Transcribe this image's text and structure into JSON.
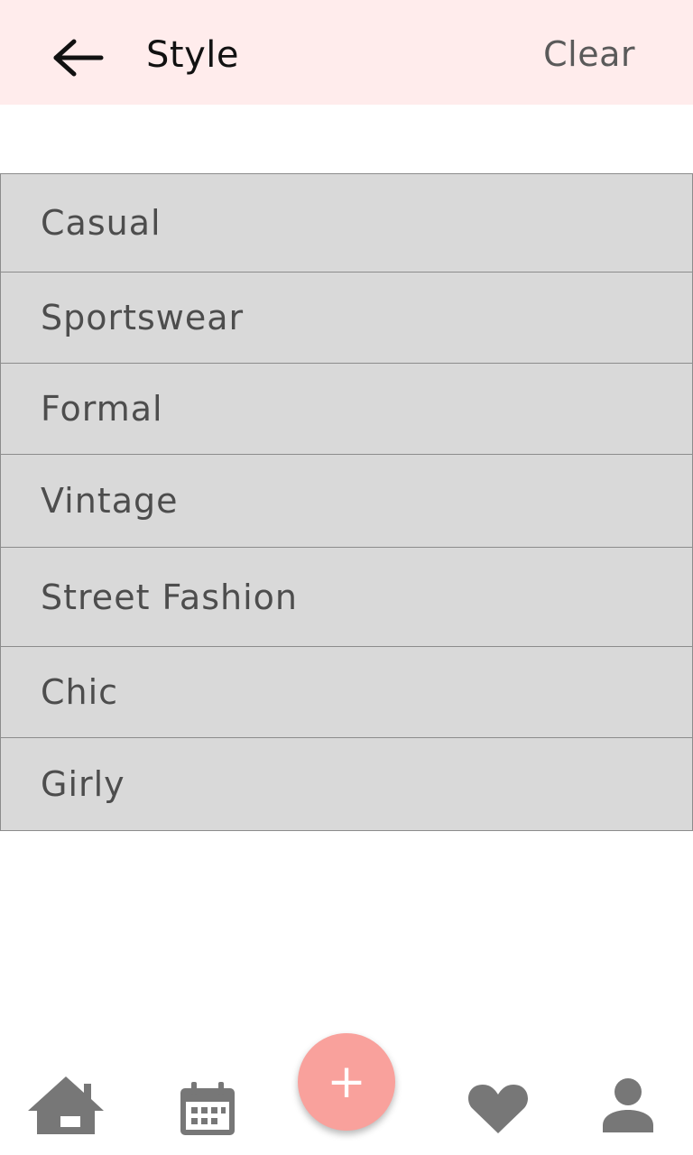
{
  "header": {
    "title": "Style",
    "clear_label": "Clear",
    "back_icon": "arrow-left-icon",
    "background": "#ffecec"
  },
  "styles": {
    "items": [
      {
        "label": "Casual"
      },
      {
        "label": "Sportswear"
      },
      {
        "label": "Formal"
      },
      {
        "label": "Vintage"
      },
      {
        "label": "Street Fashion"
      },
      {
        "label": "Chic"
      },
      {
        "label": "Girly"
      }
    ]
  },
  "bottom_nav": {
    "items": [
      {
        "icon": "home-icon"
      },
      {
        "icon": "calendar-icon"
      },
      {
        "icon": "heart-icon"
      },
      {
        "icon": "profile-icon"
      }
    ],
    "fab": {
      "label": "+",
      "icon": "plus-icon",
      "color": "#f9a19c"
    },
    "icon_color": "#777777"
  },
  "colors": {
    "list_background": "#d9d9d9",
    "list_border": "#8c8c8c",
    "text": "#4d4d4d"
  }
}
